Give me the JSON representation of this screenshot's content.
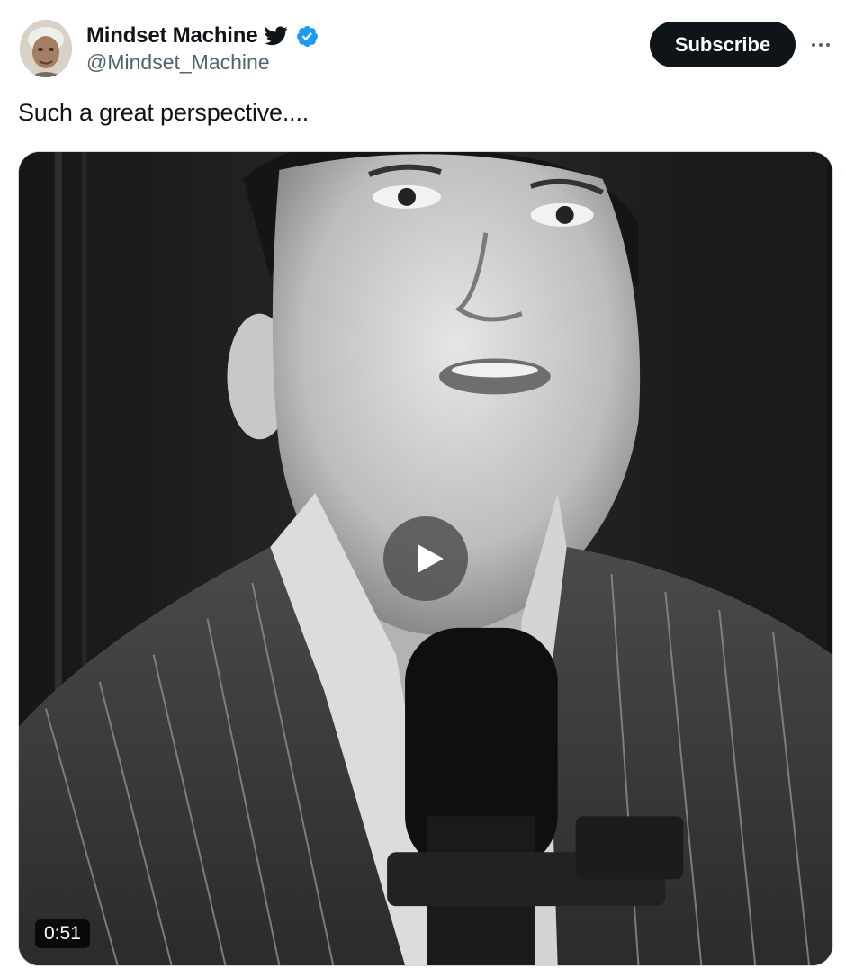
{
  "author": {
    "name": "Mindset Machine",
    "handle": "@Mindset_Machine",
    "verified": true,
    "avatar_icon": "profile-avatar",
    "verified_color": "#1d9bf0"
  },
  "actions": {
    "subscribe_label": "Subscribe",
    "more_icon": "more-dots-icon"
  },
  "tweet": {
    "text": "Such a great perspective...."
  },
  "media": {
    "type": "video",
    "duration": "0:51",
    "play_icon": "play-icon"
  }
}
